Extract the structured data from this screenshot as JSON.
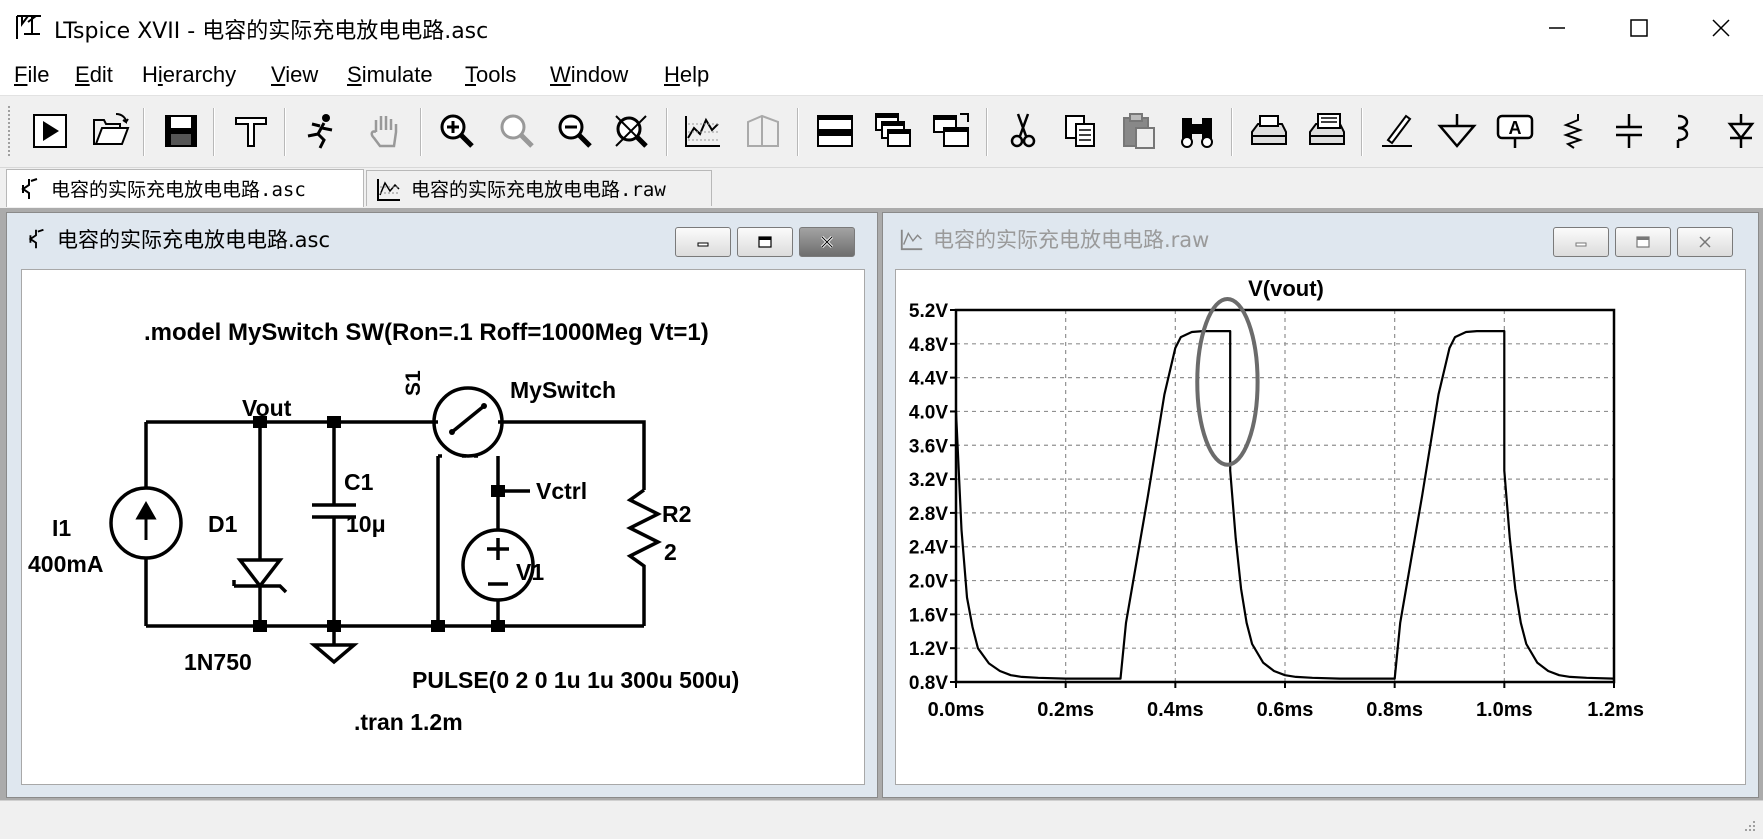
{
  "window": {
    "title": "LTspice XVII - 电容的实际充电放电电路.asc",
    "app_icon": "ltspice-logo-icon"
  },
  "menu": [
    {
      "label": "File",
      "accel": "F"
    },
    {
      "label": "Edit",
      "accel": "E"
    },
    {
      "label": "Hierarchy",
      "accel": "i"
    },
    {
      "label": "View",
      "accel": "V"
    },
    {
      "label": "Simulate",
      "accel": "S"
    },
    {
      "label": "Tools",
      "accel": "T"
    },
    {
      "label": "Window",
      "accel": "W"
    },
    {
      "label": "Help",
      "accel": "H"
    }
  ],
  "toolbar": {
    "buttons": [
      "run-icon",
      "open-icon",
      "save-icon",
      "control-panel-icon",
      "halt-icon",
      "pan-hand-icon",
      "zoom-in-icon",
      "zoom-pan-icon",
      "zoom-out-icon",
      "zoom-fit-icon",
      "autorange-icon",
      "fft-icon",
      "tile-horizontal-icon",
      "cascade-icon",
      "tile-vertical-icon",
      "cut-icon",
      "copy-icon",
      "paste-icon",
      "find-icon",
      "print-preview-icon",
      "print-icon",
      "draw-wire-icon",
      "ground-icon",
      "label-net-icon",
      "resistor-icon",
      "capacitor-icon",
      "inductor-icon",
      "diode-icon"
    ]
  },
  "tabs": [
    {
      "label": "电容的实际充电放电电路.asc",
      "icon": "schematic-icon",
      "active": true
    },
    {
      "label": "电容的实际充电放电电路.raw",
      "icon": "waveform-icon",
      "active": false
    }
  ],
  "schematic_window": {
    "title": "电容的实际充电放电电路.asc",
    "model_directive": ".model MySwitch SW(Ron=.1 Roff=1000Meg Vt=1)",
    "labels": {
      "vout": "Vout",
      "s1": "S1",
      "myswitch": "MySwitch",
      "c1": "C1",
      "c1_val": "10μ",
      "vctrl": "Vctrl",
      "r2": "R2",
      "r2_val": "2",
      "i1": "I1",
      "i1_val": "400mA",
      "d1": "D1",
      "d1_val": "1N750",
      "v1": "V1",
      "pulse": "PULSE(0 2 0 1u 1u 300u 500u)",
      "tran": ".tran 1.2m"
    }
  },
  "waveform_window": {
    "title": "电容的实际充电放电电路.raw"
  },
  "chart_data": {
    "type": "line",
    "title": "V(vout)",
    "xlabel": "",
    "ylabel": "",
    "xlim": [
      0,
      1.2
    ],
    "ylim": [
      0.8,
      5.2
    ],
    "x_ticks": [
      "0.0ms",
      "0.2ms",
      "0.4ms",
      "0.6ms",
      "0.8ms",
      "1.0ms",
      "1.2ms"
    ],
    "y_ticks": [
      "0.8V",
      "1.2V",
      "1.6V",
      "2.0V",
      "2.4V",
      "2.8V",
      "3.2V",
      "3.6V",
      "4.0V",
      "4.4V",
      "4.8V",
      "5.2V"
    ],
    "grid": true,
    "series": [
      {
        "name": "V(vout)",
        "color": "#000000",
        "x": [
          0,
          0.01,
          0.02,
          0.03,
          0.04,
          0.06,
          0.08,
          0.1,
          0.12,
          0.15,
          0.2,
          0.25,
          0.3,
          0.31,
          0.35,
          0.38,
          0.4,
          0.41,
          0.43,
          0.45,
          0.5,
          0.5,
          0.51,
          0.52,
          0.53,
          0.54,
          0.56,
          0.58,
          0.6,
          0.62,
          0.65,
          0.7,
          0.75,
          0.8,
          0.81,
          0.85,
          0.88,
          0.9,
          0.91,
          0.93,
          0.95,
          1.0,
          1.0,
          1.01,
          1.02,
          1.03,
          1.04,
          1.06,
          1.08,
          1.1,
          1.12,
          1.15,
          1.2
        ],
        "y": [
          4.0,
          2.6,
          1.8,
          1.45,
          1.2,
          1.02,
          0.93,
          0.88,
          0.86,
          0.85,
          0.84,
          0.84,
          0.84,
          1.5,
          3.0,
          4.2,
          4.75,
          4.88,
          4.94,
          4.95,
          4.95,
          3.3,
          2.5,
          1.9,
          1.5,
          1.25,
          1.03,
          0.93,
          0.88,
          0.86,
          0.85,
          0.84,
          0.84,
          0.84,
          1.5,
          3.0,
          4.2,
          4.75,
          4.88,
          4.94,
          4.95,
          4.95,
          3.3,
          2.5,
          1.9,
          1.5,
          1.25,
          1.03,
          0.93,
          0.88,
          0.86,
          0.85,
          0.84
        ]
      }
    ],
    "annotations": [
      {
        "type": "ellipse",
        "color": "#6b6b6b",
        "cx": 0.495,
        "cy": 4.35,
        "rx": 0.055,
        "ry": 0.98
      }
    ]
  },
  "statusbar": {
    "text": ""
  }
}
